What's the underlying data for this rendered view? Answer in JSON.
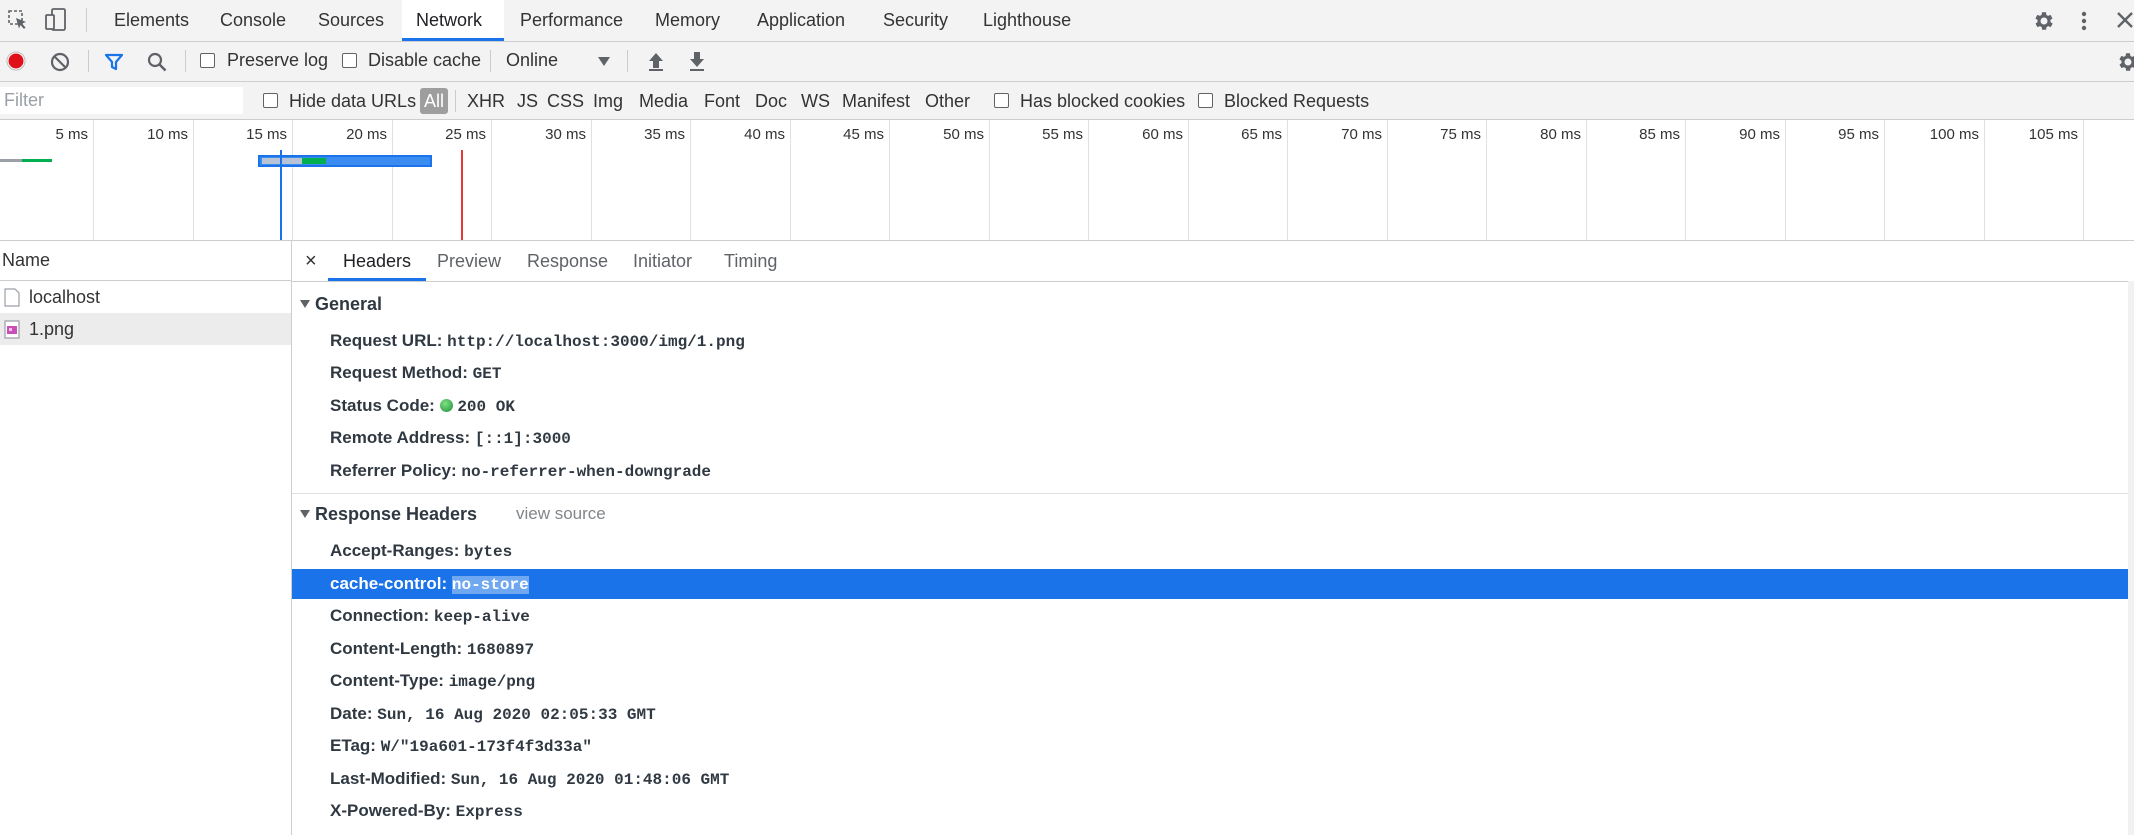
{
  "tabs": [
    "Elements",
    "Console",
    "Sources",
    "Network",
    "Performance",
    "Memory",
    "Application",
    "Security",
    "Lighthouse"
  ],
  "active_tab": "Network",
  "toolbar": {
    "preserve_log": "Preserve log",
    "disable_cache": "Disable cache",
    "throttle": "Online"
  },
  "filterbar": {
    "placeholder": "Filter",
    "hide_data_urls": "Hide data URLs",
    "types": [
      "All",
      "XHR",
      "JS",
      "CSS",
      "Img",
      "Media",
      "Font",
      "Doc",
      "WS",
      "Manifest",
      "Other"
    ],
    "has_blocked_cookies": "Has blocked cookies",
    "blocked_requests": "Blocked Requests"
  },
  "timeline": {
    "ticks": [
      "5 ms",
      "10 ms",
      "15 ms",
      "20 ms",
      "25 ms",
      "30 ms",
      "35 ms",
      "40 ms",
      "45 ms",
      "50 ms",
      "55 ms",
      "60 ms",
      "65 ms",
      "70 ms",
      "75 ms",
      "80 ms",
      "85 ms",
      "90 ms",
      "95 ms",
      "100 ms",
      "105 ms"
    ],
    "colors": {
      "dom_content_loaded": "#1a73e8",
      "load": "#e53935",
      "download": "#00b050",
      "waiting": "#1a73e8"
    }
  },
  "list": {
    "header": "Name",
    "rows": [
      "localhost",
      "1.png"
    ]
  },
  "details": {
    "close": "×",
    "tabs": [
      "Headers",
      "Preview",
      "Response",
      "Initiator",
      "Timing"
    ],
    "active_tab": "Headers",
    "general": {
      "title": "General",
      "rows": [
        {
          "key": "Request URL:",
          "value": "http://localhost:3000/img/1.png"
        },
        {
          "key": "Request Method:",
          "value": "GET"
        },
        {
          "key": "Status Code:",
          "value": "200 OK"
        },
        {
          "key": "Remote Address:",
          "value": "[::1]:3000"
        },
        {
          "key": "Referrer Policy:",
          "value": "no-referrer-when-downgrade"
        }
      ]
    },
    "response_headers": {
      "title": "Response Headers",
      "view_source": "view source",
      "rows": [
        {
          "key": "Accept-Ranges:",
          "value": "bytes"
        },
        {
          "key": "cache-control:",
          "value": "no-store"
        },
        {
          "key": "Connection:",
          "value": "keep-alive"
        },
        {
          "key": "Content-Length:",
          "value": "1680897"
        },
        {
          "key": "Content-Type:",
          "value": "image/png"
        },
        {
          "key": "Date:",
          "value": "Sun, 16 Aug 2020 02:05:33 GMT"
        },
        {
          "key": "ETag:",
          "value": "W/\"19a601-173f4f3d33a\""
        },
        {
          "key": "Last-Modified:",
          "value": "Sun, 16 Aug 2020 01:48:06 GMT"
        },
        {
          "key": "X-Powered-By:",
          "value": "Express"
        }
      ]
    },
    "status_color": "#1e8e3e",
    "selected_color": "#1a73e8"
  }
}
